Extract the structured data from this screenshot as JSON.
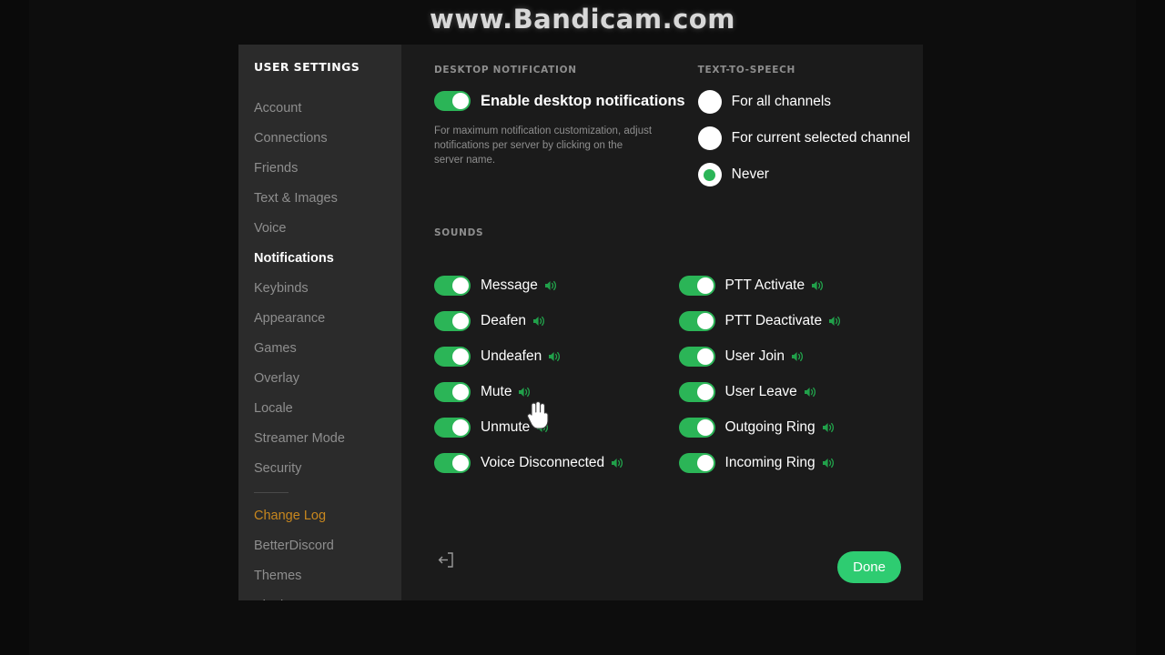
{
  "watermark": "www.Bandicam.com",
  "sidebar": {
    "title": "USER SETTINGS",
    "items": [
      {
        "label": "Account",
        "state": "normal"
      },
      {
        "label": "Connections",
        "state": "normal"
      },
      {
        "label": "Friends",
        "state": "normal"
      },
      {
        "label": "Text & Images",
        "state": "normal"
      },
      {
        "label": "Voice",
        "state": "normal"
      },
      {
        "label": "Notifications",
        "state": "active"
      },
      {
        "label": "Keybinds",
        "state": "normal"
      },
      {
        "label": "Appearance",
        "state": "normal"
      },
      {
        "label": "Games",
        "state": "normal"
      },
      {
        "label": "Overlay",
        "state": "normal"
      },
      {
        "label": "Locale",
        "state": "normal"
      },
      {
        "label": "Streamer Mode",
        "state": "normal"
      },
      {
        "label": "Security",
        "state": "normal"
      },
      {
        "label": "Change Log",
        "state": "accent"
      },
      {
        "label": "BetterDiscord",
        "state": "normal"
      },
      {
        "label": "Themes",
        "state": "normal"
      },
      {
        "label": "Plugins",
        "state": "normal"
      }
    ],
    "active_label": "Notifications",
    "accent_label": "Change Log"
  },
  "desktop_notification": {
    "section_label": "DESKTOP NOTIFICATION",
    "toggle_label": "Enable desktop notifications",
    "toggle_on": true,
    "help_text": "For maximum notification customization, adjust notifications per server by clicking on the server name."
  },
  "text_to_speech": {
    "section_label": "TEXT-TO-SPEECH",
    "options": [
      {
        "label": "For all channels",
        "selected": false
      },
      {
        "label": "For current selected channel",
        "selected": false
      },
      {
        "label": "Never",
        "selected": true
      }
    ],
    "selected_option": "Never"
  },
  "sounds": {
    "section_label": "SOUNDS",
    "left_column": [
      {
        "label": "Message",
        "on": true
      },
      {
        "label": "Deafen",
        "on": true
      },
      {
        "label": "Undeafen",
        "on": true
      },
      {
        "label": "Mute",
        "on": true
      },
      {
        "label": "Unmute",
        "on": true
      },
      {
        "label": "Voice Disconnected",
        "on": true
      }
    ],
    "right_column": [
      {
        "label": "PTT Activate",
        "on": true
      },
      {
        "label": "PTT Deactivate",
        "on": true
      },
      {
        "label": "User Join",
        "on": true
      },
      {
        "label": "User Leave",
        "on": true
      },
      {
        "label": "Outgoing Ring",
        "on": true
      },
      {
        "label": "Incoming Ring",
        "on": true
      }
    ]
  },
  "footer": {
    "done_label": "Done",
    "logout_icon": "logout-icon"
  },
  "colors": {
    "accent_green": "#2ecc71",
    "toggle_green": "#2bb557",
    "change_log_orange": "#c8871e",
    "sidebar_bg": "#2b2b2b",
    "content_bg": "#1b1b1b"
  }
}
